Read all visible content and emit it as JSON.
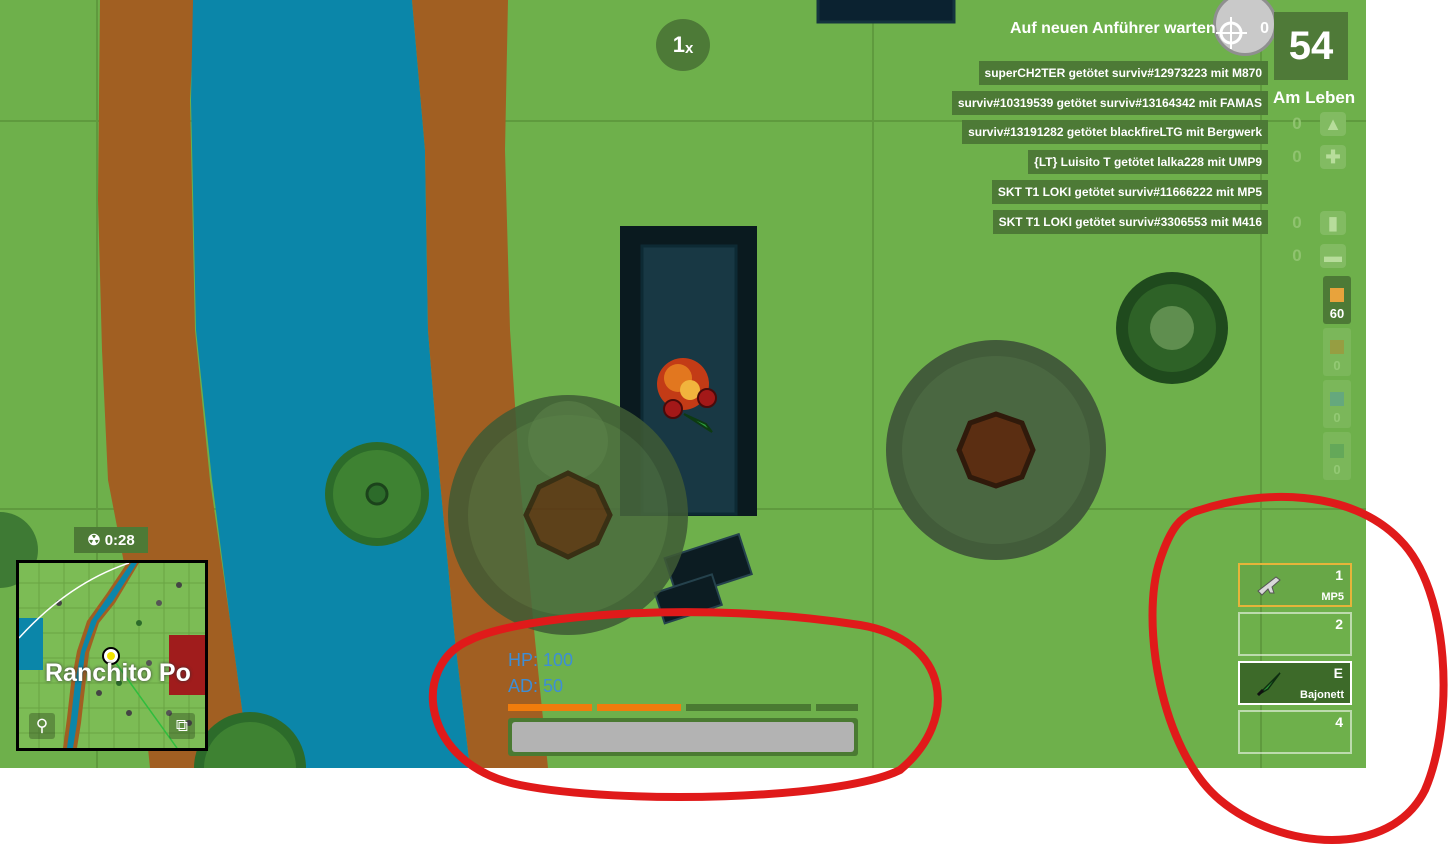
{
  "zoom": {
    "value": "1",
    "suffix": "x"
  },
  "leader": {
    "text": "Auf neuen Anführer warten",
    "count": "0"
  },
  "alive": {
    "count": "54",
    "label": "Am Leben"
  },
  "killfeed": [
    "superCH2TER getötet surviv#12973223 mit M870",
    "surviv#10319539 getötet surviv#13164342 mit FAMAS",
    "surviv#13191282 getötet blackfireLTG mit Bergwerk",
    "{LT} Luisito T getötet lalka228 mit UMP9",
    "SKT T1 LOKI getötet surviv#11666222 mit MP5",
    "SKT T1 LOKI getötet surviv#3306553 mit M416"
  ],
  "inventory": [
    {
      "count": "0",
      "icon": "helmet-icon"
    },
    {
      "count": "0",
      "icon": "medkit-icon"
    },
    {
      "count": "0",
      "icon": "soda-icon"
    },
    {
      "count": "0",
      "icon": "bandage-icon"
    }
  ],
  "ammo": [
    {
      "count": "60",
      "color": "#e8a33c"
    },
    {
      "count": "0",
      "color": "#b1862a"
    },
    {
      "count": "0",
      "color": "#4f9aa0"
    },
    {
      "count": "0",
      "color": "#4e9a57"
    }
  ],
  "weapons": [
    {
      "key": "1",
      "label": "MP5",
      "icon": "smg-icon",
      "state": "selected"
    },
    {
      "key": "2",
      "label": "",
      "icon": "",
      "state": "empty"
    },
    {
      "key": "E",
      "label": "Bajonett",
      "icon": "bayonet-icon",
      "state": "equipped"
    },
    {
      "key": "4",
      "label": "",
      "icon": "",
      "state": "empty"
    }
  ],
  "stats": {
    "hp": "HP: 100",
    "ad": "AD: 50",
    "health_fraction": 1.0
  },
  "boost_bar": [
    {
      "color": "#f07c0c",
      "filled": true
    },
    {
      "color": "#f07c0c",
      "filled": true
    },
    {
      "color": "#4a7a32",
      "filled": false
    },
    {
      "color": "#4a7a32",
      "filled": false
    }
  ],
  "gas_timer": {
    "icon": "radiation-icon",
    "time": "0:28"
  },
  "minimap": {
    "place_name": "Ranchito Po"
  }
}
